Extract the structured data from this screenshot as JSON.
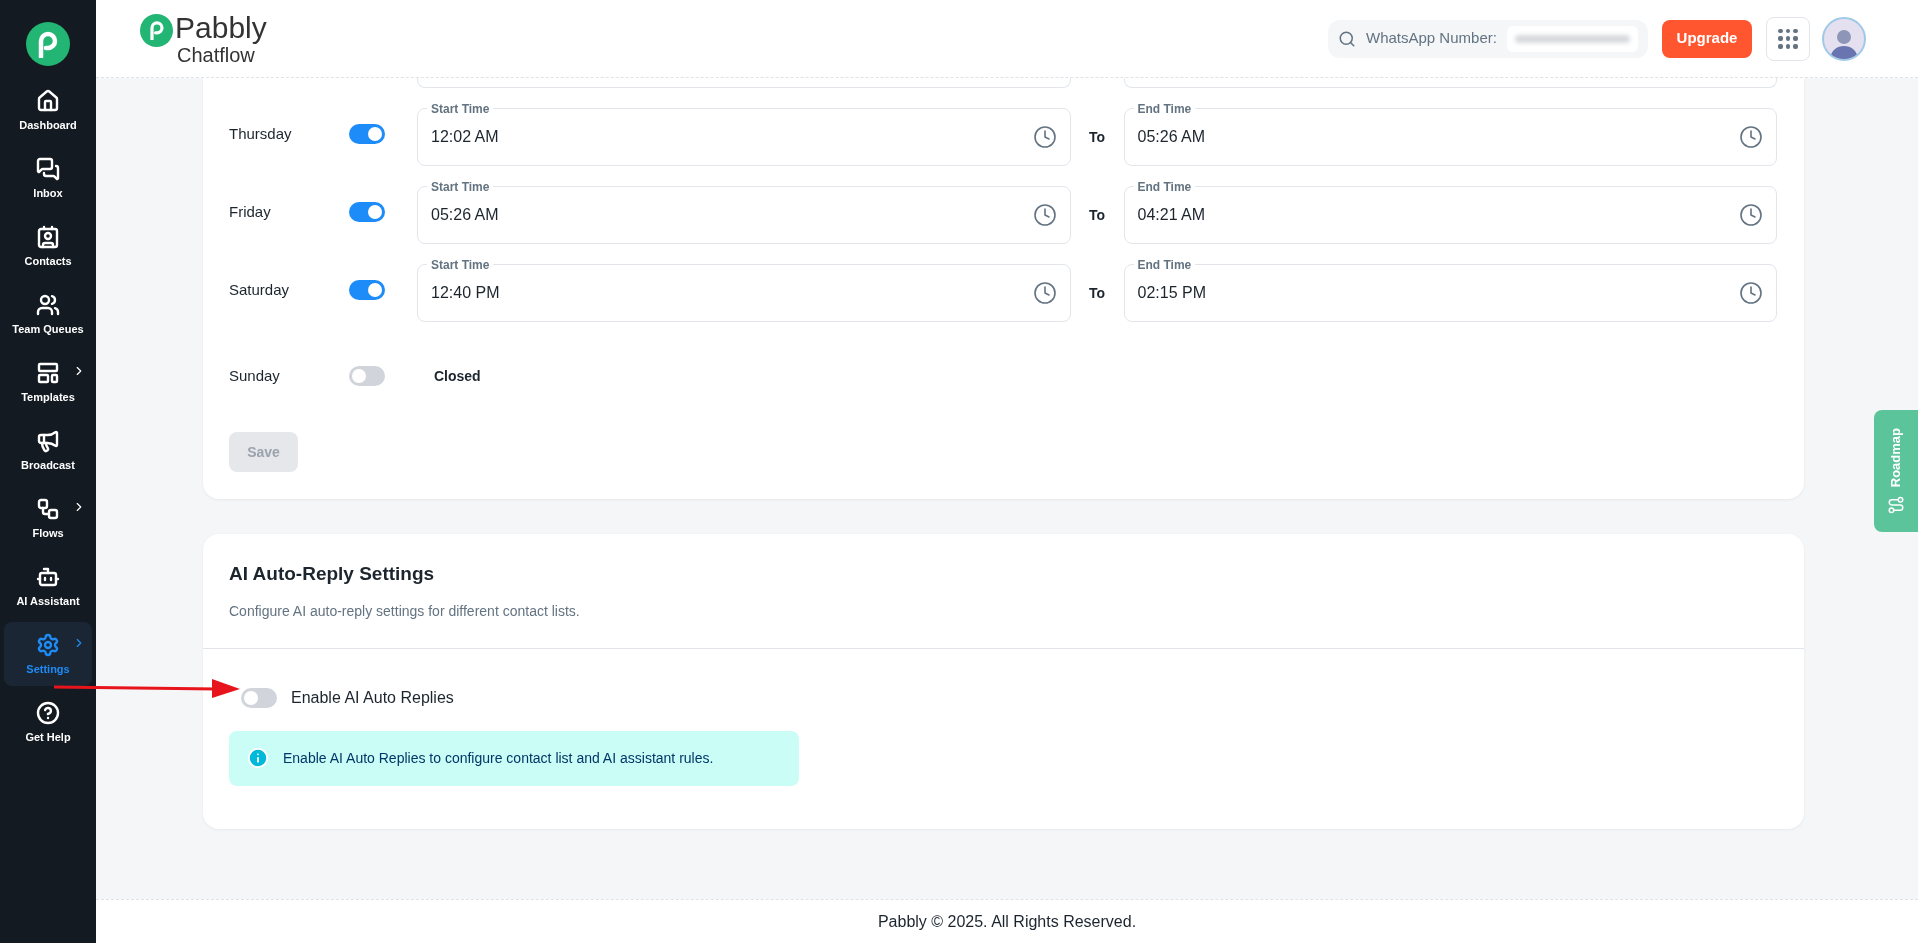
{
  "logo": {
    "name": "Pabbly",
    "product": "Chatflow"
  },
  "sidebar": {
    "items": [
      {
        "label": "Dashboard",
        "has_submenu": false,
        "selected": false
      },
      {
        "label": "Inbox",
        "has_submenu": false,
        "selected": false
      },
      {
        "label": "Contacts",
        "has_submenu": false,
        "selected": false
      },
      {
        "label": "Team Queues",
        "has_submenu": false,
        "selected": false
      },
      {
        "label": "Templates",
        "has_submenu": true,
        "selected": false
      },
      {
        "label": "Broadcast",
        "has_submenu": false,
        "selected": false
      },
      {
        "label": "Flows",
        "has_submenu": true,
        "selected": false
      },
      {
        "label": "AI Assistant",
        "has_submenu": false,
        "selected": false
      },
      {
        "label": "Settings",
        "has_submenu": true,
        "selected": true
      },
      {
        "label": "Get Help",
        "has_submenu": false,
        "selected": false
      }
    ]
  },
  "header": {
    "search_label": "WhatsApp Number:",
    "upgrade_button": "Upgrade"
  },
  "working_hours": {
    "rows": [
      {
        "day": "Thursday",
        "on": true,
        "start_label": "Start Time",
        "start": "12:02 AM",
        "to": "To",
        "end_label": "End Time",
        "end": "05:26 AM"
      },
      {
        "day": "Friday",
        "on": true,
        "start_label": "Start Time",
        "start": "05:26 AM",
        "to": "To",
        "end_label": "End Time",
        "end": "04:21 AM"
      },
      {
        "day": "Saturday",
        "on": true,
        "start_label": "Start Time",
        "start": "12:40 PM",
        "to": "To",
        "end_label": "End Time",
        "end": "02:15 PM"
      },
      {
        "day": "Sunday",
        "on": false,
        "closed_text": "Closed"
      }
    ],
    "save_button": {
      "label": "Save",
      "disabled": true
    }
  },
  "ai_auto_reply": {
    "title": "AI Auto-Reply Settings",
    "description": "Configure AI auto-reply settings for different contact lists.",
    "toggle": {
      "label": "Enable AI Auto Replies",
      "on": false
    },
    "info": "Enable AI Auto Replies to configure contact list and AI assistant rules."
  },
  "roadmap": {
    "label": "Roadmap"
  },
  "footer": "Pabbly © 2025. All Rights Reserved."
}
